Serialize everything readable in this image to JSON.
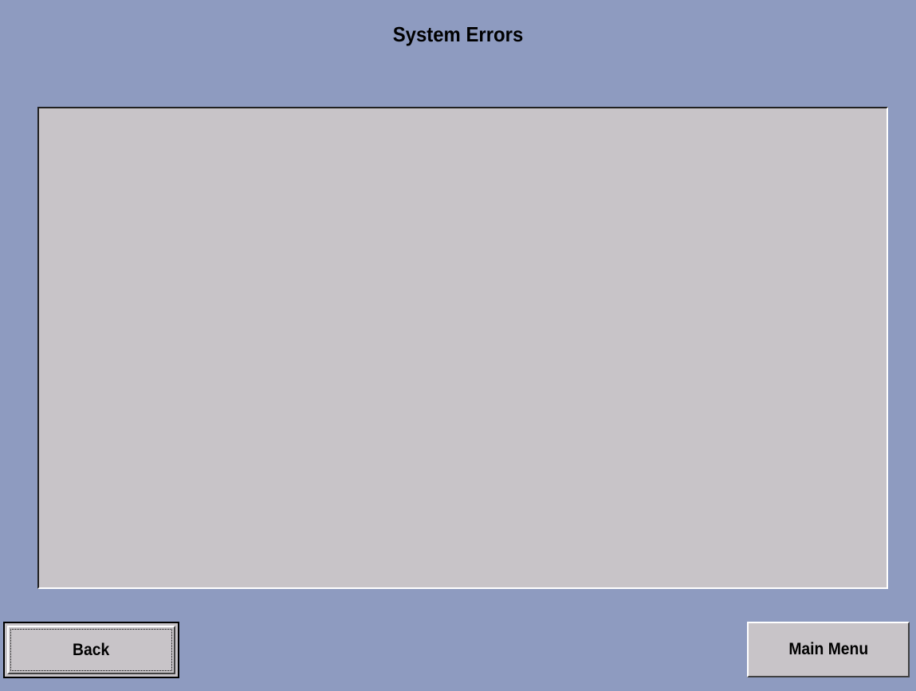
{
  "screen": {
    "title": "System Errors",
    "background_color": "#8e9bc0"
  },
  "error_list": {
    "items": [],
    "background_color": "#c8c4c8"
  },
  "buttons": {
    "back_label": "Back",
    "main_menu_label": "Main Menu"
  }
}
